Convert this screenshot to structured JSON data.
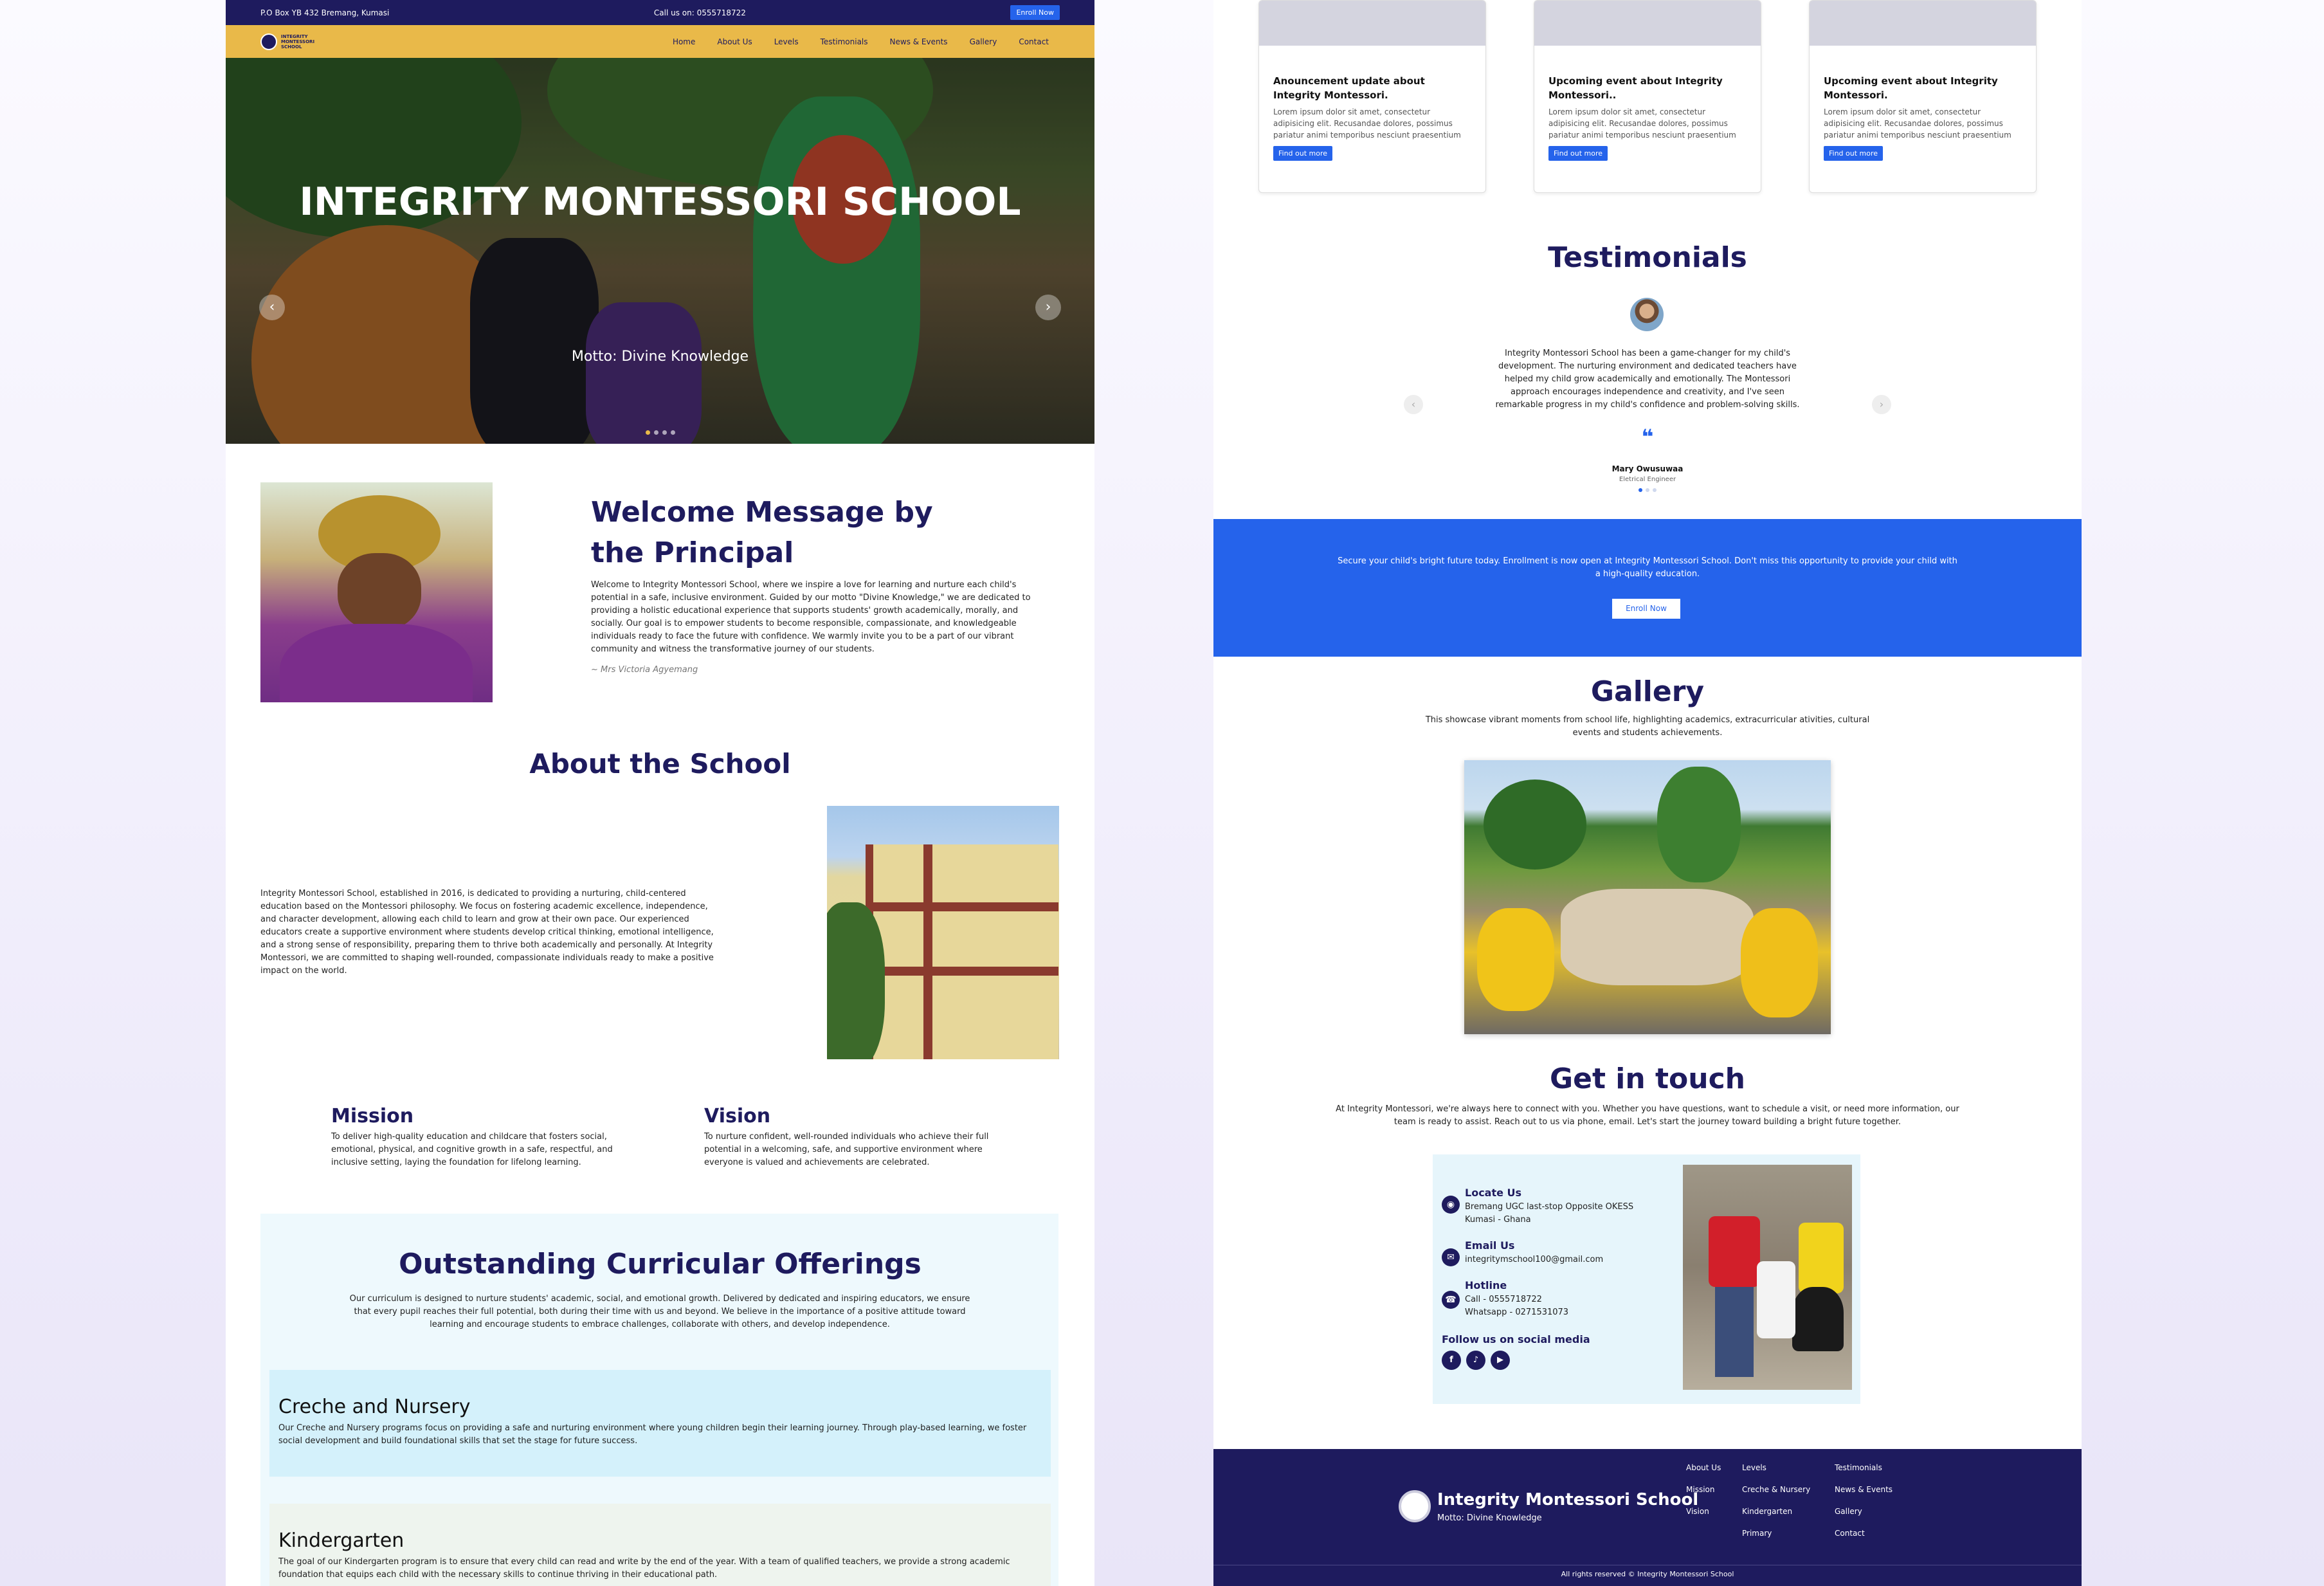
{
  "topbar": {
    "address": "P.O Box YB 432 Bremang, Kumasi",
    "call": "Call us on: 0555718722",
    "enroll": "Enroll Now"
  },
  "logo": {
    "text": "INTEGRITY MONTESSORI SCHOOL"
  },
  "nav": {
    "items": [
      "Home",
      "About Us",
      "Levels",
      "Testimonials",
      "News & Events",
      "Gallery",
      "Contact"
    ]
  },
  "hero": {
    "title": "INTEGRITY MONTESSORI SCHOOL",
    "motto": "Motto: Divine Knowledge",
    "prev": "‹",
    "next": "›"
  },
  "welcome": {
    "title": "Welcome Message by the Principal",
    "body": "Welcome to Integrity Montessori School, where we inspire a love for learning and nurture each child's potential in a safe, inclusive environment. Guided by our motto \"Divine Knowledge,\" we are dedicated to providing a holistic educational experience that supports students' growth academically, morally, and socially. Our goal is to empower students to become responsible, compassionate, and knowledgeable individuals ready to face the future with confidence. We warmly invite you to be a part of our vibrant community and witness the transformative journey of our students.",
    "signature": "~ Mrs Victoria Agyemang"
  },
  "about": {
    "title": "About the School",
    "body": "Integrity Montessori School, established in 2016, is dedicated to providing a nurturing, child-centered education based on the Montessori philosophy. We focus on fostering academic excellence, independence, and character development, allowing each child to learn and grow at their own pace. Our experienced educators create a supportive environment where students develop critical thinking, emotional intelligence, and a strong sense of responsibility, preparing them to thrive both academically and personally. At Integrity Montessori, we are committed to shaping well-rounded, compassionate individuals ready to make a positive impact on the world."
  },
  "mission": {
    "title": "Mission",
    "body": "To deliver high-quality education and childcare that fosters social, emotional, physical, and cognitive growth in a safe, respectful, and inclusive setting, laying the foundation for lifelong learning."
  },
  "vision": {
    "title": "Vision",
    "body": "To nurture confident, well-rounded individuals who achieve their full potential in a welcoming, safe, and supportive environment where everyone is valued and achievements are celebrated."
  },
  "offerings": {
    "title": "Outstanding Curricular Offerings",
    "body": "Our curriculum is designed to nurture students' academic, social, and emotional growth. Delivered by dedicated and inspiring educators, we ensure that every pupil reaches their full potential, both during their time with us and beyond. We believe in the importance of a positive attitude toward learning and encourage students to embrace challenges, collaborate with others, and develop independence.",
    "cards": [
      {
        "title": "Creche and Nursery",
        "body": "Our Creche and Nursery programs focus on providing a safe and nurturing environment where young children begin their learning journey. Through play-based learning, we foster social development and build foundational skills that set the stage for future success.",
        "color": "#d4f1fb"
      },
      {
        "title": "Kindergarten",
        "body": "The goal of our Kindergarten program is to ensure that every child can read and write by the end of the year. With a team of qualified teachers, we provide a strong academic foundation that equips each child with the necessary skills to continue thriving in their educational path.",
        "color": "#eef4ee"
      }
    ]
  },
  "news": [
    {
      "title": "Anouncement update about Integrity Montessori.",
      "text": "Lorem ipsum dolor sit amet, consectetur adipisicing elit. Recusandae dolores, possimus pariatur animi temporibus nesciunt praesentium",
      "button": "Find out more"
    },
    {
      "title": "Upcoming event about Integrity Montessori..",
      "text": "Lorem ipsum dolor sit amet, consectetur adipisicing elit. Recusandae dolores, possimus pariatur animi temporibus nesciunt praesentium",
      "button": "Find out more"
    },
    {
      "title": "Upcoming event about Integrity Montessori.",
      "text": "Lorem ipsum dolor sit amet, consectetur adipisicing elit. Recusandae dolores, possimus pariatur animi temporibus nesciunt praesentium",
      "button": "Find out more"
    }
  ],
  "testimonials": {
    "title": "Testimonials",
    "text": "Integrity Montessori School has been a game-changer for my child's development. The nurturing environment and dedicated teachers have helped my child grow academically and emotionally. The Montessori approach encourages independence and creativity, and I've seen remarkable progress in my child's confidence and problem-solving skills.",
    "quote": "❝",
    "name": "Mary Owusuwaa",
    "role": "Eletrical Engineer",
    "prev": "‹",
    "next": "›"
  },
  "cta": {
    "text": "Secure your child's bright future today. Enrollment is now open at Integrity Montessori School. Don't miss this opportunity to provide your child with a high-quality education.",
    "button": "Enroll Now"
  },
  "gallery": {
    "title": "Gallery",
    "subtitle": "This showcase vibrant moments from school life, highlighting academics, extracurricular ativities, cultural events and students achievements."
  },
  "contact": {
    "title": "Get in touch",
    "text": "At Integrity Montessori, we're always here to connect with you. Whether you have questions, want to schedule a visit, or need more information, our team is ready to assist. Reach out to us via phone, email. Let's start the journey toward building a bright future together.",
    "locate_head": "Locate Us",
    "locate_1": "Bremang UGC last-stop Opposite OKESS",
    "locate_2": "Kumasi - Ghana",
    "email_head": "Email Us",
    "email": "integritymschool100@gmail.com",
    "hotline_head": "Hotline",
    "call": "Call - 0555718722",
    "whatsapp": "Whatsapp - 0271531073",
    "social_head": "Follow us on social media"
  },
  "footer": {
    "name": "Integrity Montessori School",
    "motto": "Motto: Divine Knowledge",
    "col1": [
      "About Us",
      "Mission",
      "Vision"
    ],
    "col2": [
      "Levels",
      "Creche & Nursery",
      "Kindergarten",
      "Primary"
    ],
    "col3": [
      "Testimonials",
      "News & Events",
      "Gallery",
      "Contact"
    ],
    "copyright": "All rights reserved © Integrity Montessori School"
  },
  "colors": {
    "navy": "#1e1b5e",
    "gold": "#e9b949",
    "blue": "#2563eb"
  }
}
